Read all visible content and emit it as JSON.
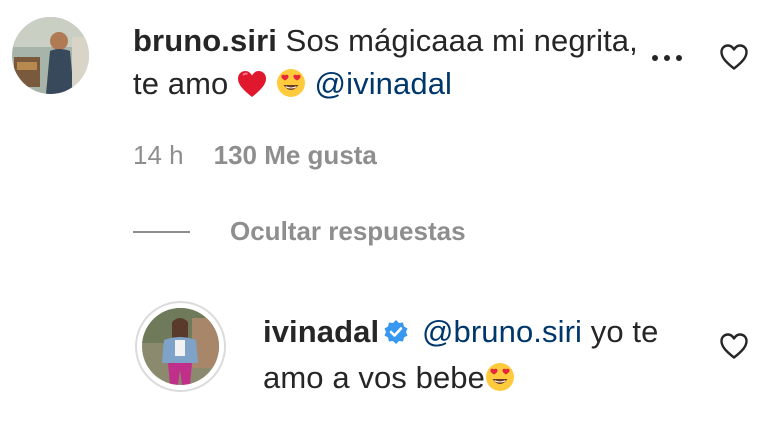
{
  "comment": {
    "username": "bruno.siri",
    "text_before": "Sos mágicaaa mi negrita, te amo",
    "emoji_1": "❤️",
    "emoji_2": "😍",
    "mention": "@ivinadal",
    "time": "14 h",
    "likes": "130 Me gusta",
    "more_icon": "more-horizontal-icon",
    "like_icon": "heart-outline-icon"
  },
  "replies_toggle": {
    "label": "Ocultar respuestas"
  },
  "reply": {
    "username": "ivinadal",
    "verified_icon": "verified-badge-icon",
    "verified_color": "#3897f0",
    "mention": "@bruno.siri",
    "text_after": "yo te amo a vos bebe",
    "emoji": "😍",
    "like_icon": "heart-outline-icon"
  },
  "colors": {
    "text": "#262626",
    "secondary": "#8e8e8e",
    "mention": "#00376b"
  }
}
